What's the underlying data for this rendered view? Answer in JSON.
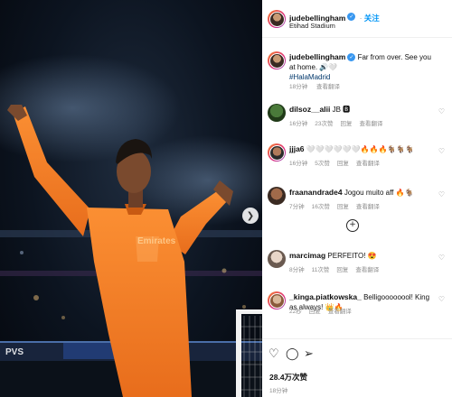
{
  "post": {
    "author": "judebellingham",
    "follow_label": "关注",
    "location": "Etihad Stadium",
    "likes": "28.4万次赞",
    "age": "18分钟"
  },
  "caption": {
    "username": "judebellingham",
    "text": "Far from over. See you at home. 🔊🤍",
    "hashtag": "#HalaMadrid",
    "time": "18分钟",
    "translate": "查看翻译"
  },
  "comments": [
    {
      "username": "dilsoz__alii",
      "text": "JB 🅱",
      "time": "16分钟",
      "likes": "23次赞",
      "reply": "回复",
      "translate": "查看翻译"
    },
    {
      "username": "jjja6",
      "text": "🤍🤍🤍🤍🤍🤍🔥🔥🔥🐐🐐🐐",
      "time": "16分钟",
      "likes": "5次赞",
      "reply": "回复",
      "translate": "查看翻译"
    },
    {
      "username": "fraanandrade4",
      "text": "Jogou muito aff 🔥🐐",
      "time": "7分钟",
      "likes": "16次赞",
      "reply": "回复",
      "translate": "查看翻译"
    },
    {
      "username": "marcimag",
      "text": "PERFEITO! 😍",
      "time": "8分钟",
      "likes": "11次赞",
      "reply": "回复",
      "translate": "查看翻译"
    },
    {
      "username": "_kinga.piatkowska_",
      "text": "Belligoooooool! King as always! 👑🔥",
      "time": "22秒",
      "likes": "",
      "reply": "回复",
      "translate": "查看翻译"
    }
  ],
  "icons": {
    "carousel_next": "chevron-right-icon",
    "verified": "verified-badge-icon",
    "heart": "heart-icon",
    "comment": "comment-icon",
    "share": "share-icon",
    "more": "plus-circle-icon"
  },
  "photo_text": {
    "shirt_sponsor": "Emirates",
    "board_text": "PVS"
  },
  "colors": {
    "kit_orange": "#f7812a",
    "link_blue": "#0095f6",
    "verified_blue": "#3897f0",
    "stadium_dark": "#0c1420"
  }
}
